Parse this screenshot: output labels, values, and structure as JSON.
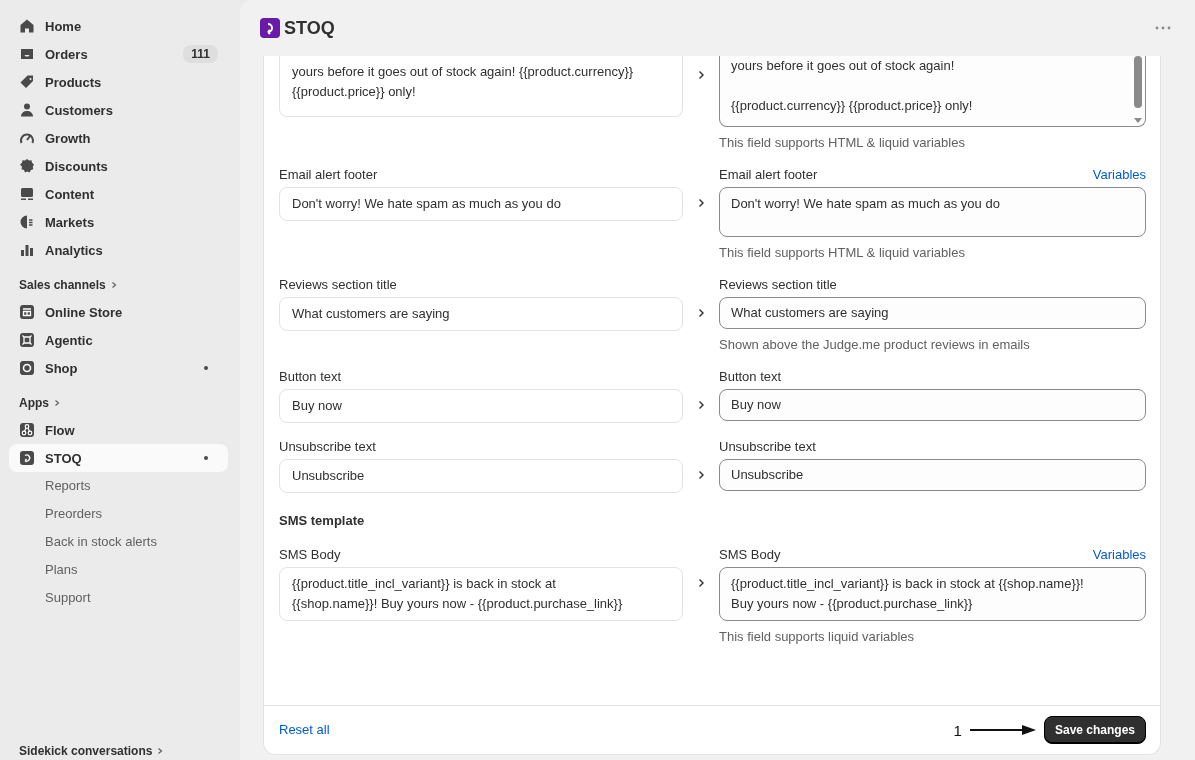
{
  "sidebar": {
    "nav": [
      {
        "label": "Home"
      },
      {
        "label": "Orders",
        "badge": "111"
      },
      {
        "label": "Products"
      },
      {
        "label": "Customers"
      },
      {
        "label": "Growth"
      },
      {
        "label": "Discounts"
      },
      {
        "label": "Content"
      },
      {
        "label": "Markets"
      },
      {
        "label": "Analytics"
      }
    ],
    "sales_channels": {
      "title": "Sales channels",
      "items": [
        {
          "label": "Online Store",
          "dot": false
        },
        {
          "label": "Agentic",
          "dot": false
        },
        {
          "label": "Shop",
          "dot": true
        }
      ]
    },
    "apps": {
      "title": "Apps",
      "items": [
        {
          "label": "Flow",
          "dot": false,
          "selected": false
        },
        {
          "label": "STOQ",
          "dot": true,
          "selected": true
        }
      ],
      "subitems": [
        "Reports",
        "Preorders",
        "Back in stock alerts",
        "Plans",
        "Support"
      ]
    },
    "footer_section": "Sidekick conversations"
  },
  "header": {
    "title": "STOQ"
  },
  "rows": [
    {
      "left_value": "yours before it goes out of stock again! {{product.currency}}\n{{product.price}} only!",
      "right_value": "yours before it goes out of stock again!\n\n{{product.currency}} {{product.price}} only!",
      "kind": "textarea",
      "help": "This field supports HTML & liquid variables"
    },
    {
      "left_label": "Email alert footer",
      "left_value": "Don't worry! We hate spam as much as you do",
      "right_label": "Email alert footer",
      "right_value": "Don't worry! We hate spam as much as you do",
      "kind": "textarea",
      "variables": "Variables",
      "help": "This field supports HTML & liquid variables"
    },
    {
      "left_label": "Reviews section title",
      "left_value": "What customers are saying",
      "right_label": "Reviews section title",
      "right_value": "What customers are saying",
      "kind": "input",
      "help": "Shown above the Judge.me product reviews in emails"
    },
    {
      "left_label": "Button text",
      "left_value": "Buy now",
      "right_label": "Button text",
      "right_value": "Buy now",
      "kind": "input"
    },
    {
      "left_label": "Unsubscribe text",
      "left_value": "Unsubscribe",
      "right_label": "Unsubscribe text",
      "right_value": "Unsubscribe",
      "kind": "input"
    }
  ],
  "sms": {
    "heading": "SMS template",
    "rows": [
      {
        "left_label": "SMS Body",
        "left_value": "{{product.title_incl_variant}} is back in stock at\n{{shop.name}}! Buy yours now - {{product.purchase_link}}",
        "right_label": "SMS Body",
        "right_value": "{{product.title_incl_variant}} is back in stock at {{shop.name}}!\nBuy yours now - {{product.purchase_link}}",
        "kind": "textarea",
        "variables": "Variables",
        "help": "This field supports liquid variables"
      }
    ]
  },
  "footer": {
    "reset": "Reset all",
    "annotation": "1",
    "save": "Save changes"
  }
}
